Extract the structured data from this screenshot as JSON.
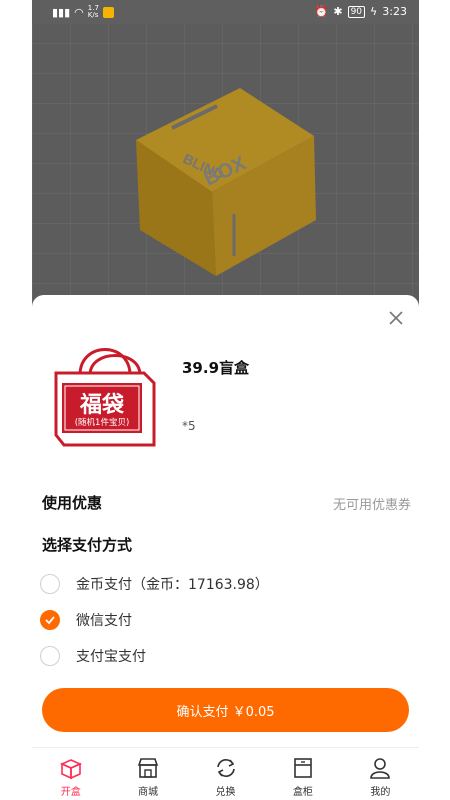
{
  "status_bar": {
    "net_speed": "1.7\nK/s",
    "battery": "90",
    "time": "3:23"
  },
  "modal": {
    "product": {
      "bag_main_text": "福袋",
      "bag_sub_text": "(随机1件宝贝)",
      "title": "39.9盲盒",
      "quantity": "*5"
    },
    "coupon": {
      "label": "使用优惠",
      "value": "无可用优惠券"
    },
    "payment": {
      "label": "选择支付方式",
      "options": [
        {
          "label": "金币支付（金币：17163.98）",
          "selected": false
        },
        {
          "label": "微信支付",
          "selected": true
        },
        {
          "label": "支付宝支付",
          "selected": false
        }
      ]
    },
    "confirm_label": "确认支付 ￥0.05"
  },
  "tabbar": {
    "tabs": [
      {
        "label": "开盒",
        "icon": "box-open-icon",
        "active": true
      },
      {
        "label": "商城",
        "icon": "store-icon",
        "active": false
      },
      {
        "label": "兑换",
        "icon": "exchange-icon",
        "active": false
      },
      {
        "label": "盒柜",
        "icon": "cabinet-icon",
        "active": false
      },
      {
        "label": "我的",
        "icon": "user-icon",
        "active": false
      }
    ]
  },
  "colors": {
    "accent": "#ff6a00",
    "tab_active": "#ff2e55",
    "bag_red": "#c81c2c"
  }
}
